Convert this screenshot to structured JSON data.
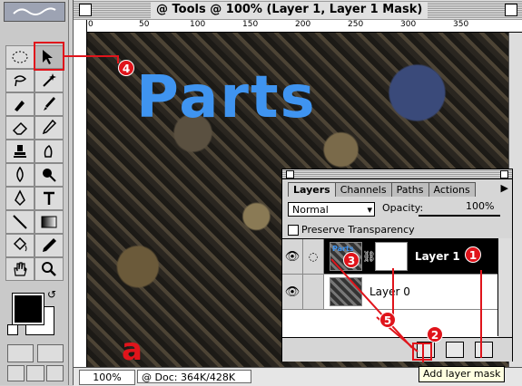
{
  "window": {
    "title": "@ Tools @ 100% (Layer 1, Layer 1 Mask)"
  },
  "ruler": {
    "ticks": [
      "0",
      "50",
      "100",
      "150",
      "200",
      "250",
      "300",
      "350"
    ]
  },
  "canvas": {
    "headline": "Parts",
    "corner_label": "a"
  },
  "status": {
    "zoom": "100%",
    "doc_info": "@ Doc: 364K/428K"
  },
  "layers_palette": {
    "tabs": [
      "Layers",
      "Channels",
      "Paths",
      "Actions"
    ],
    "blend_mode": "Normal",
    "opacity_label": "Opacity:",
    "opacity_value": "100%",
    "preserve_transparency": "Preserve Transparency",
    "thumb_text": "Parts",
    "layers": [
      {
        "name": "Layer 1",
        "active": true
      },
      {
        "name": "Layer 0",
        "active": false
      }
    ]
  },
  "tooltip": "Add layer mask",
  "callouts": [
    "1",
    "2",
    "3",
    "4",
    "5"
  ],
  "colors": {
    "accent": "#e0141b",
    "headline": "#3f94f0"
  }
}
